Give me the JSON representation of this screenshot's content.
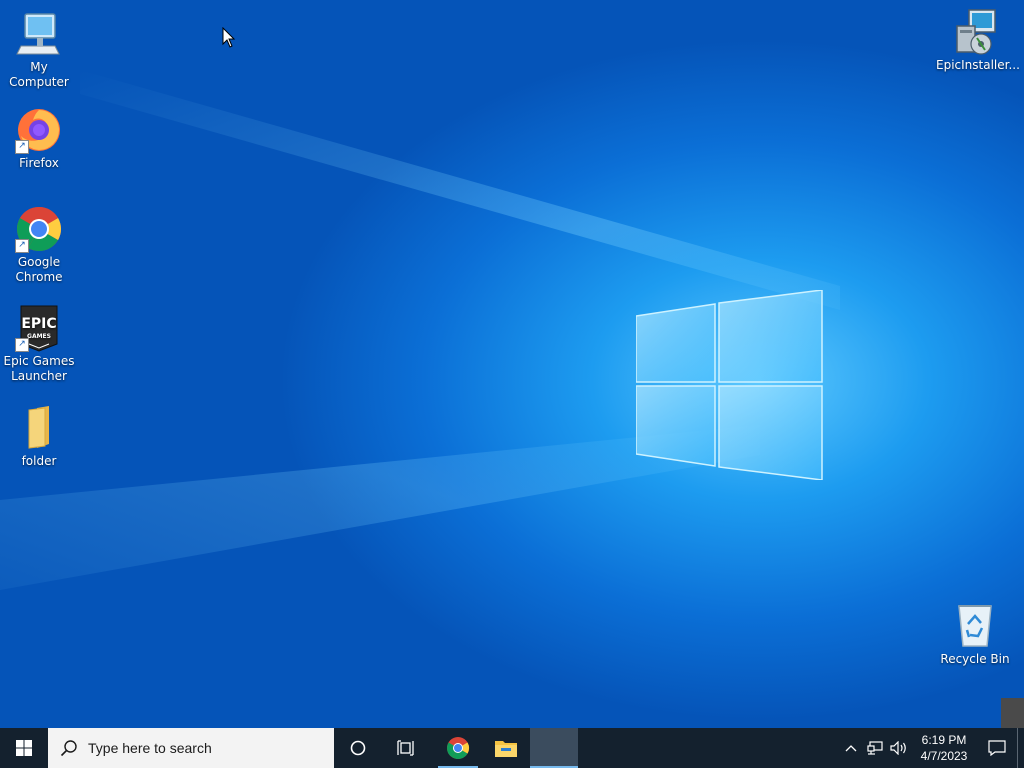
{
  "desktop": {
    "icons": [
      {
        "label": "My Computer",
        "icon": "computer-icon"
      },
      {
        "label": "Firefox",
        "icon": "firefox-icon"
      },
      {
        "label": "Google Chrome",
        "icon": "chrome-icon"
      },
      {
        "label": "Epic Games Launcher",
        "icon": "epic-games-icon"
      },
      {
        "label": "folder",
        "icon": "folder-icon"
      },
      {
        "label": "EpicInstaller...",
        "icon": "installer-icon"
      },
      {
        "label": "Recycle Bin",
        "icon": "recycle-bin-icon"
      }
    ],
    "epic_logo_text": "EPIC",
    "epic_logo_subtext": "GAMES"
  },
  "taskbar": {
    "search_placeholder": "Type here to search",
    "clock_time": "6:19 PM",
    "clock_date": "4/7/2023",
    "pinned": [
      "windows-start-icon",
      "cortana-icon",
      "task-view-icon",
      "chrome-icon",
      "file-explorer-icon"
    ]
  },
  "colors": {
    "taskbar_bg": "#14212e",
    "desktop_accent": "#1d9cf0",
    "active_indicator": "#76b9ed"
  }
}
